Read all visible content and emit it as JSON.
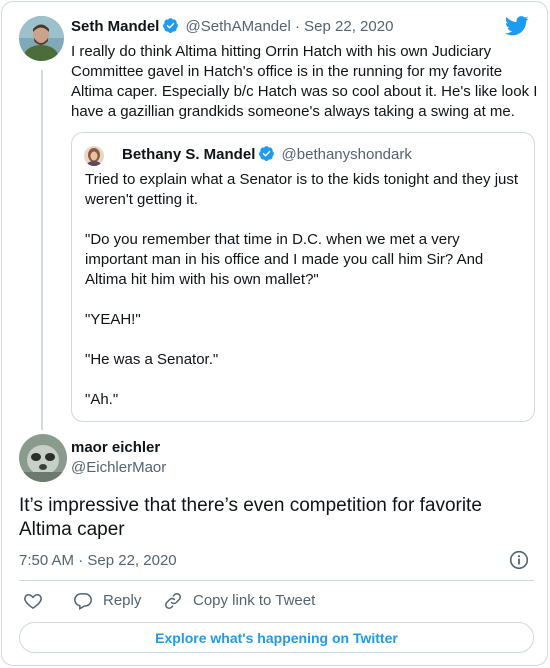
{
  "parent_tweet": {
    "author_name": "Seth Mandel",
    "handle": "@SethAMandel",
    "separator": "·",
    "date": "Sep 22, 2020",
    "text": "I really do think Altima hitting Orrin Hatch with his own Judiciary Committee gavel in Hatch's office is in the running for my favorite Altima caper. Especially b/c Hatch was so cool about it. He's like look I have a gazillian grandkids someone's always taking a swing at me."
  },
  "quoted_tweet": {
    "author_name": "Bethany S. Mandel",
    "handle": "@bethanyshondark",
    "paragraphs": [
      "Tried to explain what a Senator is to the kids tonight and they just weren't getting it.",
      "\"Do you remember that time in D.C. when we met a very important man in his office and I made you call him Sir? And Altima hit him with his own mallet?\"",
      "\"YEAH!\"",
      "\"He was a Senator.\"",
      "\"Ah.\""
    ]
  },
  "reply_tweet": {
    "author_name": "maor eichler",
    "handle": "@EichlerMaor",
    "text": "It’s impressive that there’s even competition for favorite Altima caper",
    "time": "7:50 AM",
    "separator": "·",
    "date": "Sep 22, 2020"
  },
  "actions": {
    "reply_label": "Reply",
    "copy_label": "Copy link to Tweet"
  },
  "footer": {
    "explore_label": "Explore what's happening on Twitter"
  },
  "colors": {
    "accent": "#1d9bf0",
    "text": "#0f1419",
    "muted": "#536471",
    "border": "#cfd9de"
  },
  "icons": [
    "verified-badge-icon",
    "twitter-bird-icon",
    "info-icon",
    "heart-icon",
    "reply-bubble-icon",
    "link-icon"
  ]
}
